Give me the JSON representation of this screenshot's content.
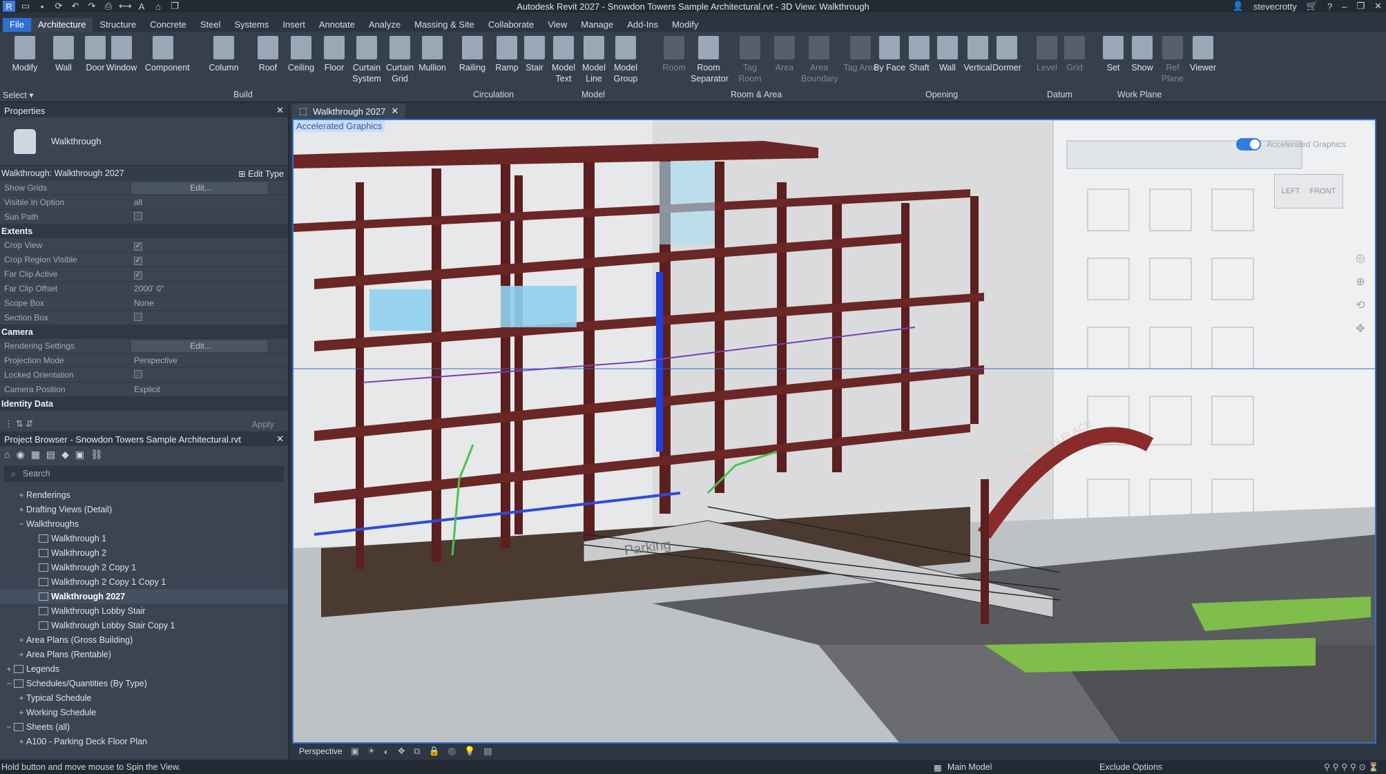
{
  "app": {
    "window_title": "Autodesk Revit 2027 - Snowdon Towers Sample Architectural.rvt - 3D View: Walkthrough",
    "user": "stevecrotty",
    "qat_icons": [
      "revit-logo-icon",
      "open-icon",
      "save-icon",
      "sync-icon",
      "undo-icon",
      "redo-icon",
      "print-icon",
      "measure-icon",
      "text-icon",
      "3d-view-icon",
      "switch-windows-icon"
    ]
  },
  "menu": {
    "tabs": [
      "File",
      "Architecture",
      "Structure",
      "Concrete",
      "Steel",
      "Systems",
      "Insert",
      "Annotate",
      "Analyze",
      "Massing & Site",
      "Collaborate",
      "View",
      "Manage",
      "Add-Ins",
      "Modify"
    ],
    "active": "Architecture"
  },
  "ribbon": {
    "select_label": "Select",
    "buttons": [
      {
        "label": "Modify",
        "icon": "modify-cursor-icon"
      },
      {
        "label": "Wall",
        "icon": "wall-icon"
      },
      {
        "label": "Door",
        "icon": "door-icon"
      },
      {
        "label": "Window",
        "icon": "window-icon"
      },
      {
        "label": "Component",
        "icon": "component-icon"
      },
      {
        "label": "Column",
        "icon": "column-icon"
      },
      {
        "label": "Roof",
        "icon": "roof-icon"
      },
      {
        "label": "Ceiling",
        "icon": "ceiling-icon"
      },
      {
        "label": "Floor",
        "icon": "floor-icon"
      },
      {
        "label": "Curtain System",
        "icon": "curtain-system-icon"
      },
      {
        "label": "Curtain Grid",
        "icon": "curtain-grid-icon"
      },
      {
        "label": "Mullion",
        "icon": "mullion-icon"
      },
      {
        "label": "Railing",
        "icon": "railing-icon"
      },
      {
        "label": "Ramp",
        "icon": "ramp-icon"
      },
      {
        "label": "Stair",
        "icon": "stair-icon"
      },
      {
        "label": "Model Text",
        "icon": "model-text-icon"
      },
      {
        "label": "Model Line",
        "icon": "model-line-icon"
      },
      {
        "label": "Model Group",
        "icon": "model-group-icon"
      },
      {
        "label": "Room",
        "icon": "room-icon",
        "dim": true
      },
      {
        "label": "Room Separator",
        "icon": "room-separator-icon"
      },
      {
        "label": "Tag Room",
        "icon": "tag-room-icon",
        "dim": true
      },
      {
        "label": "Area",
        "icon": "area-icon",
        "dim": true
      },
      {
        "label": "Area Boundary",
        "icon": "area-boundary-icon",
        "dim": true
      },
      {
        "label": "Tag Area",
        "icon": "tag-area-icon",
        "dim": true
      },
      {
        "label": "By Face",
        "icon": "by-face-icon"
      },
      {
        "label": "Shaft",
        "icon": "shaft-icon"
      },
      {
        "label": "Wall",
        "icon": "wall-opening-icon"
      },
      {
        "label": "Vertical",
        "icon": "vertical-opening-icon"
      },
      {
        "label": "Dormer",
        "icon": "dormer-icon"
      },
      {
        "label": "Level",
        "icon": "level-icon",
        "dim": true
      },
      {
        "label": "Grid",
        "icon": "grid-icon",
        "dim": true
      },
      {
        "label": "Set",
        "icon": "set-workplane-icon"
      },
      {
        "label": "Show",
        "icon": "show-workplane-icon"
      },
      {
        "label": "Ref Plane",
        "icon": "ref-plane-icon",
        "dim": true
      },
      {
        "label": "Viewer",
        "icon": "viewer-icon"
      }
    ],
    "groups": [
      "Build",
      "Circulation",
      "Model",
      "Room & Area",
      "Opening",
      "Datum",
      "Work Plane"
    ]
  },
  "properties": {
    "title": "Properties",
    "type_name": "Walkthrough",
    "instance_label": "Walkthrough: Walkthrough 2027",
    "edit_type": "Edit Type",
    "rows": [
      {
        "k": "Show Grids",
        "v": "Edit...",
        "kind": "button"
      },
      {
        "k": "Visible In Option",
        "v": "all",
        "kind": "text"
      },
      {
        "k": "Sun Path",
        "v": "",
        "kind": "check-off"
      }
    ],
    "categories": [
      {
        "name": "Extents",
        "rows": [
          {
            "k": "Crop View",
            "v": "",
            "kind": "check-on"
          },
          {
            "k": "Crop Region Visible",
            "v": "",
            "kind": "check-on"
          },
          {
            "k": "Far Clip Active",
            "v": "",
            "kind": "check-on"
          },
          {
            "k": "Far Clip Offset",
            "v": "2000'  0\"",
            "kind": "text"
          },
          {
            "k": "Scope Box",
            "v": "None",
            "kind": "text"
          },
          {
            "k": "Section Box",
            "v": "",
            "kind": "check-off"
          }
        ]
      },
      {
        "name": "Camera",
        "rows": [
          {
            "k": "Rendering Settings",
            "v": "Edit...",
            "kind": "button"
          },
          {
            "k": "Projection Mode",
            "v": "Perspective",
            "kind": "text"
          },
          {
            "k": "Locked Orientation",
            "v": "",
            "kind": "check-off"
          },
          {
            "k": "Camera Position",
            "v": "Explicit",
            "kind": "text"
          }
        ]
      },
      {
        "name": "Identity Data",
        "rows": []
      }
    ],
    "apply_label": "Apply"
  },
  "browser": {
    "title": "Project Browser - Snowdon Towers Sample Architectural.rvt",
    "search_placeholder": "Search",
    "items": [
      {
        "label": "Renderings",
        "indent": 1,
        "toggle": "+"
      },
      {
        "label": "Drafting Views (Detail)",
        "indent": 1,
        "toggle": "+"
      },
      {
        "label": "Walkthroughs",
        "indent": 1,
        "toggle": "−"
      },
      {
        "label": "Walkthrough 1",
        "indent": 2,
        "toggle": "",
        "icon": true
      },
      {
        "label": "Walkthrough 2",
        "indent": 2,
        "toggle": "",
        "icon": true
      },
      {
        "label": "Walkthrough 2 Copy 1",
        "indent": 2,
        "toggle": "",
        "icon": true
      },
      {
        "label": "Walkthrough 2 Copy 1 Copy 1",
        "indent": 2,
        "toggle": "",
        "icon": true
      },
      {
        "label": "Walkthrough 2027",
        "indent": 2,
        "toggle": "",
        "icon": true,
        "selected": true
      },
      {
        "label": "Walkthrough Lobby Stair",
        "indent": 2,
        "toggle": "",
        "icon": true
      },
      {
        "label": "Walkthrough Lobby Stair Copy 1",
        "indent": 2,
        "toggle": "",
        "icon": true
      },
      {
        "label": "Area Plans (Gross Building)",
        "indent": 1,
        "toggle": "+"
      },
      {
        "label": "Area Plans (Rentable)",
        "indent": 1,
        "toggle": "+"
      },
      {
        "label": "Legends",
        "indent": 0,
        "toggle": "+",
        "icon": true
      },
      {
        "label": "Schedules/Quantities (By Type)",
        "indent": 0,
        "toggle": "−",
        "icon": true
      },
      {
        "label": "Typical Schedule",
        "indent": 1,
        "toggle": "+"
      },
      {
        "label": "Working Schedule",
        "indent": 1,
        "toggle": "+"
      },
      {
        "label": "Sheets (all)",
        "indent": 0,
        "toggle": "−",
        "icon": true
      },
      {
        "label": "A100 - Parking Deck Floor Plan",
        "indent": 1,
        "toggle": "+"
      }
    ]
  },
  "view": {
    "tab_label": "Walkthrough 2027",
    "accelerated_label": "Accelerated Graphics",
    "accelerated_toggle_label": "Accelerated Graphics",
    "viewcube_left": "LEFT",
    "viewcube_front": "FRONT",
    "arch_text": "SNOWDON PLACE",
    "sign_text": "Parking",
    "projection": "Perspective"
  },
  "status": {
    "message": "Hold button and move mouse to Spin the View.",
    "model": "Main Model",
    "options": "Exclude Options"
  },
  "colors": {
    "accent": "#2f6fd1",
    "steel": "#5c1f1f",
    "glass": "#7fc6e8",
    "grass": "#7fbe4a"
  }
}
